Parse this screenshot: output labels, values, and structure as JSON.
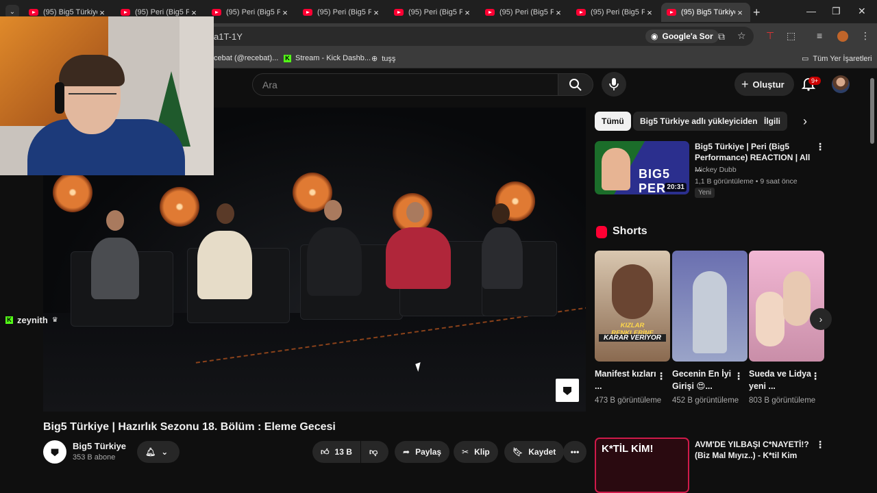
{
  "tabs": [
    {
      "title": "(95) Big5 Türkiye",
      "active": false
    },
    {
      "title": "(95) Peri (Big5 Pe",
      "active": false
    },
    {
      "title": "(95) Peri (Big5 Pe",
      "active": false
    },
    {
      "title": "(95) Peri (Big5 Pe",
      "active": false
    },
    {
      "title": "(95) Peri (Big5 Pe",
      "active": false
    },
    {
      "title": "(95) Peri (Big5 Pe",
      "active": false
    },
    {
      "title": "(95) Peri (Big5 Pe",
      "active": false
    },
    {
      "title": "(95) Big5 Türkiye",
      "active": true
    }
  ],
  "omnibox": {
    "url_fragment": "a1T-1Y",
    "google_ask": "Google'a Sor"
  },
  "bookmarks": {
    "items": [
      "cebat (@recebat)...",
      "Stream - Kick Dashb...",
      "tuşş"
    ],
    "all_bookmarks": "Tüm Yer İşaretleri"
  },
  "youtube": {
    "search_placeholder": "Ara",
    "create_label": "Oluştur",
    "notif_badge": "9+",
    "video": {
      "title": "Big5 Türkiye | Hazırlık Sezonu 18. Bölüm : Eleme Gecesi",
      "channel": "Big5 Türkiye",
      "subscribers": "353 B abone",
      "likes": "13 B",
      "share": "Paylaş",
      "clip": "Klip",
      "save": "Kaydet"
    },
    "chips": [
      "Tümü",
      "Big5 Türkiye adlı yükleyiciden",
      "İlgili"
    ],
    "recommended": {
      "title": "Big5 Türkiye | Peri (Big5 Performance) REACTION | All ...",
      "channel": "Mickey Dubb",
      "stats": "1,1 B görüntüleme • 9 saat önce",
      "badge": "Yeni",
      "duration": "20:31",
      "thumb_text": "BIG5 PER"
    },
    "shorts": {
      "heading": "Shorts",
      "items": [
        {
          "title": "Manifest kızları ...",
          "views": "473 B görüntüleme",
          "overlay1": "KIZLAR RENKLERİNE",
          "overlay2": "KARAR VERİYOR"
        },
        {
          "title": "Gecenin En İyi Girişi 😍...",
          "views": "452 B görüntüleme"
        },
        {
          "title": "Sueda ve Lidya yeni ...",
          "views": "803 B görüntüleme"
        }
      ]
    },
    "recommended2": {
      "title": "AVM'DE YILBAŞI C*NAYETİ!? (Biz Mal Mıyız..) - K*til Kim",
      "thumb_text": "K*TİL KİM!"
    }
  },
  "overlay": {
    "chat_user": "zeynith"
  },
  "colors": {
    "yt_red": "#ff0033",
    "kick_green": "#53fc18",
    "bg": "#0f0f0f"
  }
}
